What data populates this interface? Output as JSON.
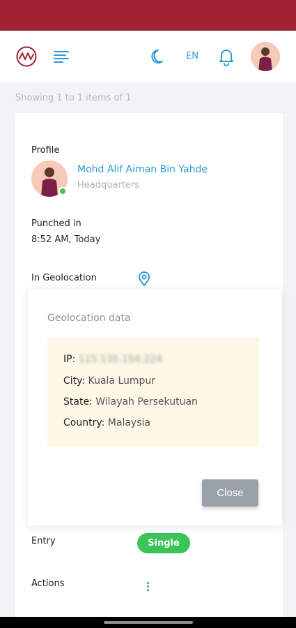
{
  "header": {
    "language": "EN",
    "icons": [
      "logo-icon",
      "menu-icon",
      "moon-icon",
      "bell-icon"
    ]
  },
  "listing": {
    "showing_text": "Showing 1 to 1 items of 1"
  },
  "profile": {
    "label": "Profile",
    "name": "Mohd Alif Aiman Bin Yahde",
    "department": "Headquarters"
  },
  "punch": {
    "label": "Punched in",
    "value": "8:52 AM, Today"
  },
  "geolocation": {
    "label": "In Geolocation",
    "modal_title": "Geolocation data",
    "rows": [
      {
        "key": "IP:",
        "value": "115.135.154.224"
      },
      {
        "key": "City:",
        "value": "Kuala Lumpur"
      },
      {
        "key": "State:",
        "value": "Wilayah Persekutuan"
      },
      {
        "key": "Country:",
        "value": "Malaysia"
      }
    ],
    "close_label": "Close"
  },
  "entry": {
    "label": "Entry",
    "badge": "Single"
  },
  "actions": {
    "label": "Actions"
  },
  "colors": {
    "brand": "#a12232",
    "accent": "#2a9bd6",
    "success": "#3cc35a"
  }
}
